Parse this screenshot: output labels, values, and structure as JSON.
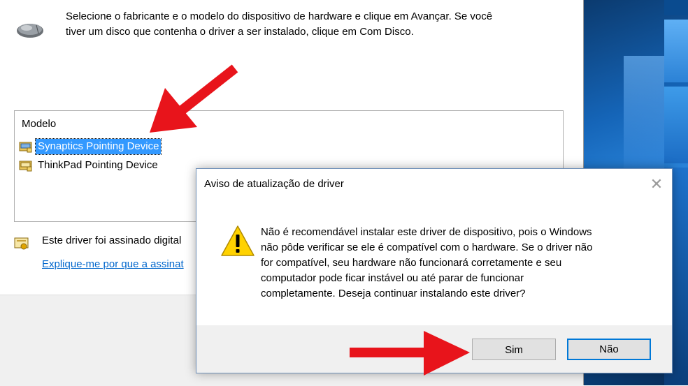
{
  "wizard": {
    "instructions": "Selecione o fabricante e o modelo do dispositivo de hardware e clique em Avançar. Se você\ntiver um disco que contenha o driver a ser instalado, clique em Com Disco.",
    "model_header": "Modelo",
    "models": [
      {
        "label": "Synaptics Pointing Device",
        "selected": true
      },
      {
        "label": "ThinkPad Pointing Device",
        "selected": false
      }
    ],
    "signed_text": "Este driver foi assinado digital",
    "signed_link": "Explique-me por que a assinat"
  },
  "dialog": {
    "title": "Aviso de atualização de driver",
    "close_glyph": "✕",
    "message": "Não é recomendável instalar este driver de dispositivo, pois o Windows\nnão pôde verificar se ele é compatível com o hardware.  Se o driver não\nfor compatível, seu hardware não funcionará corretamente e seu\ncomputador pode ficar instável ou até parar de funcionar\ncompletamente.  Deseja continuar instalando este driver?",
    "buttons": {
      "yes": "Sim",
      "no": "Não"
    }
  },
  "colors": {
    "selection": "#3399ff",
    "link": "#0066cc",
    "arrow": "#e8141b",
    "warning": "#ffd200",
    "default_button_border": "#0078d7"
  },
  "icons": [
    "mouse-icon",
    "driver-package-icon",
    "certificate-icon",
    "warning-icon",
    "close-icon"
  ]
}
